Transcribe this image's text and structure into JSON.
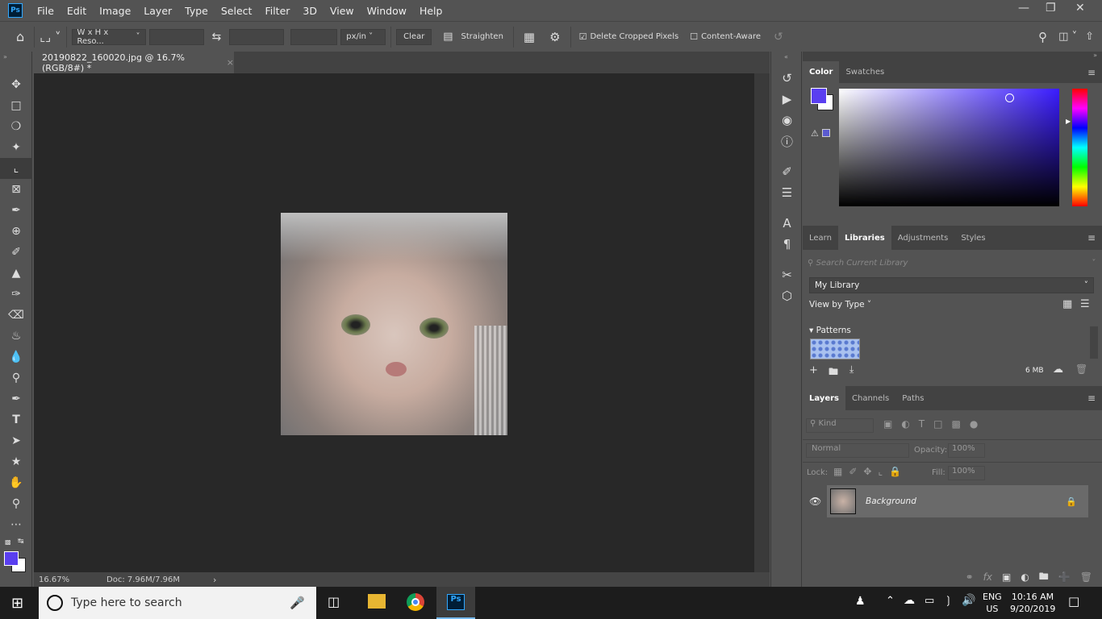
{
  "app": {
    "logo": "Ps"
  },
  "menu": [
    "File",
    "Edit",
    "Image",
    "Layer",
    "Type",
    "Select",
    "Filter",
    "3D",
    "View",
    "Window",
    "Help"
  ],
  "options": {
    "ratio": "W x H x Reso...",
    "width": "",
    "height": "",
    "resolution": "",
    "unit": "px/in",
    "clear": "Clear",
    "straighten": "Straighten",
    "delete_cropped": "Delete Cropped Pixels",
    "delete_cropped_checked": true,
    "content_aware": "Content-Aware",
    "content_aware_checked": false
  },
  "document": {
    "tab_title": "20190822_160020.jpg @ 16.7% (RGB/8#) *",
    "zoom": "16.67%",
    "doc_size": "Doc: 7.96M/7.96M"
  },
  "colors": {
    "foreground": "#5a3ff0",
    "background": "#ffffff",
    "accent": "#31a8ff"
  },
  "color_panel": {
    "tabs": [
      "Color",
      "Swatches"
    ],
    "active": "Color"
  },
  "libraries_panel": {
    "tabs": [
      "Learn",
      "Libraries",
      "Adjustments",
      "Styles"
    ],
    "active": "Libraries",
    "search_placeholder": "Search Current Library",
    "library": "My Library",
    "view_by": "View by Type",
    "section": "Patterns",
    "size": "6 MB"
  },
  "layers_panel": {
    "tabs": [
      "Layers",
      "Channels",
      "Paths"
    ],
    "active": "Layers",
    "kind": "Kind",
    "blend": "Normal",
    "opacity_label": "Opacity:",
    "opacity": "100%",
    "lock_label": "Lock:",
    "fill_label": "Fill:",
    "fill": "100%",
    "layers": [
      {
        "name": "Background",
        "visible": true,
        "locked": true
      }
    ]
  },
  "taskbar": {
    "search_placeholder": "Type here to search",
    "lang": "ENG",
    "region": "US",
    "time": "10:16 AM",
    "date": "9/20/2019"
  }
}
